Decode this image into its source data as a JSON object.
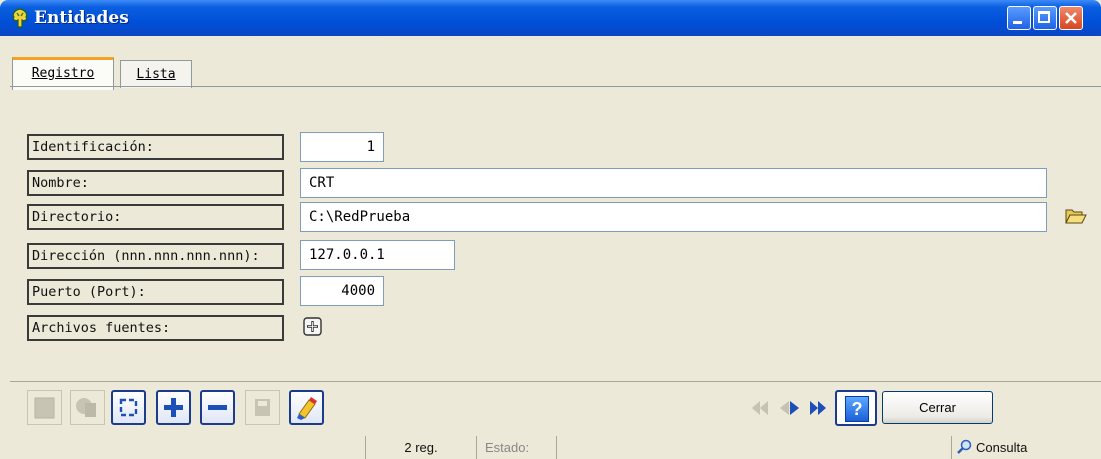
{
  "window": {
    "title": "Entidades",
    "app_icon": "tree-app-icon"
  },
  "tabs": [
    {
      "label": "Registro",
      "active": true
    },
    {
      "label": "Lista",
      "active": false
    }
  ],
  "form": {
    "identificacion": {
      "label": "Identificación:",
      "value": "1"
    },
    "nombre": {
      "label": "Nombre:",
      "value": "CRT"
    },
    "directorio": {
      "label": "Directorio:",
      "value": "C:\\RedPrueba"
    },
    "direccion": {
      "label": "Dirección (nnn.nnn.nnn.nnn):",
      "value": "127.0.0.1"
    },
    "puerto": {
      "label": "Puerto (Port):",
      "value": "4000"
    },
    "archivos": {
      "label": "Archivos fuentes:"
    }
  },
  "toolbar": {
    "buttons": [
      "new-icon",
      "copy-icon",
      "refresh-icon",
      "add-icon",
      "remove-icon",
      "save-icon",
      "clear-icon"
    ],
    "nav": [
      "first-icon",
      "prev-icon",
      "next-icon",
      "last-icon"
    ],
    "help_label": "?",
    "close_label": "Cerrar"
  },
  "statusbar": {
    "records": "2 reg.",
    "estado_label": "Estado:",
    "mode": "Consulta"
  },
  "colors": {
    "title_bar": "#0a5fe0",
    "window_bg": "#ece9d8",
    "tab_accent": "#f3a224",
    "toolbar_border": "#1d3b8c"
  }
}
